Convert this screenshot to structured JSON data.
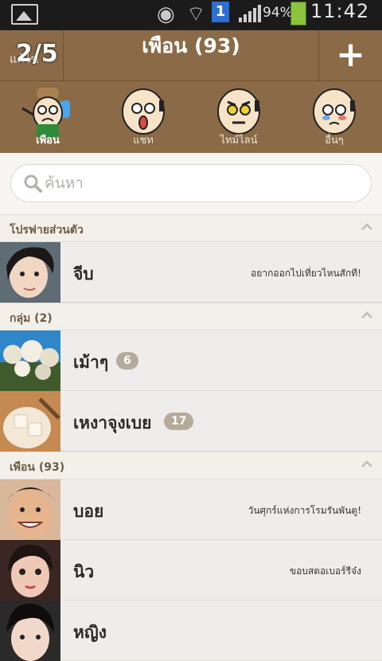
{
  "status_bar": {
    "battery": "94%",
    "time": "11:42",
    "sim_badge": "1"
  },
  "header": {
    "left_text": "แก้ไข",
    "page_indicator": "2/5",
    "title": "เพือน (93)",
    "add_label": "+"
  },
  "tabs": [
    {
      "label": "เพือน",
      "active": true
    },
    {
      "label": "แชท",
      "active": false
    },
    {
      "label": "ไทม์ไลน์",
      "active": false
    },
    {
      "label": "อื่นๆ",
      "active": false
    }
  ],
  "search": {
    "placeholder": "ค้นหา"
  },
  "sections": {
    "profile": {
      "title": "โปรฟายส่วนตัว"
    },
    "groups": {
      "title": "กลุ่ม (2)"
    },
    "friends": {
      "title": "เพือน (93)"
    }
  },
  "profile": {
    "name": "จีบ",
    "status": "อยากออกไปเที่ยวไหนสักที!"
  },
  "groups": [
    {
      "name": "เม้าๆ",
      "count": "6"
    },
    {
      "name": "เหงาจุงเบย",
      "count": "17"
    }
  ],
  "friends": [
    {
      "name": "บอย",
      "status": "วันศุกร์แห่งการโรมรันพันตู!"
    },
    {
      "name": "นิว",
      "status": "ขอบสตอเบอร์รีจ๋ง"
    },
    {
      "name": "หญิง",
      "status": ""
    }
  ],
  "colors": {
    "header_brown": "#8b6a48",
    "badge": "#b6aa9a",
    "list_bg": "#efedeb"
  }
}
